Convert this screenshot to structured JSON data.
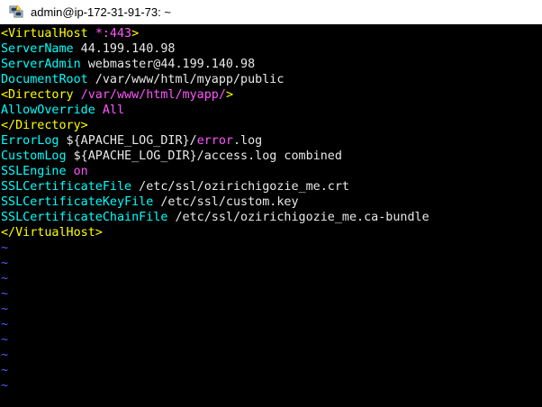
{
  "window": {
    "title": "admin@ip-172-31-91-73: ~",
    "icon": "putty-icon"
  },
  "colors": {
    "background": "#000000",
    "tag": "#ffff00",
    "directive": "#00ffff",
    "value": "#e8e8e8",
    "variable_value": "#ff55ff",
    "tilde": "#5c5cff"
  },
  "editor": {
    "lines": [
      {
        "kind": "tag",
        "open": "<VirtualHost ",
        "attr": "*:443",
        "close": ">"
      },
      {
        "kind": "kv",
        "key": "ServerName",
        "value": " 44.199.140.98"
      },
      {
        "kind": "kv",
        "key": "ServerAdmin",
        "value": " webmaster@44.199.140.98"
      },
      {
        "kind": "kv",
        "key": "DocumentRoot",
        "value": " /var/www/html/myapp/public"
      },
      {
        "kind": "tag",
        "open": "<Directory ",
        "attr": "/var/www/html/myapp/",
        "close": ">"
      },
      {
        "kind": "kvc",
        "key": "AllowOverride",
        "value": " All"
      },
      {
        "kind": "tag",
        "open": "</Directory>",
        "attr": "",
        "close": ""
      },
      {
        "kind": "errlog",
        "key": "ErrorLog",
        "pre": " ${APACHE_LOG_DIR}/",
        "mid": "error",
        "post": ".log"
      },
      {
        "kind": "kv",
        "key": "CustomLog",
        "value": " ${APACHE_LOG_DIR}/access.log combined"
      },
      {
        "kind": "kvc",
        "key": "SSLEngine",
        "value": " on"
      },
      {
        "kind": "kv",
        "key": "SSLCertificateFile",
        "value": " /etc/ssl/ozirichigozie_me.crt"
      },
      {
        "kind": "kv",
        "key": "SSLCertificateKeyFile",
        "value": " /etc/ssl/custom.key"
      },
      {
        "kind": "kv",
        "key": "SSLCertificateChainFile",
        "value": " /etc/ssl/ozirichigozie_me.ca-bundle"
      },
      {
        "kind": "tag",
        "open": "</VirtualHost>",
        "attr": "",
        "close": ""
      }
    ],
    "empty_line_marker": "~",
    "empty_lines": [
      "~",
      "~",
      "~",
      "~",
      "~",
      "~",
      "~",
      "~",
      "~",
      "~"
    ]
  }
}
